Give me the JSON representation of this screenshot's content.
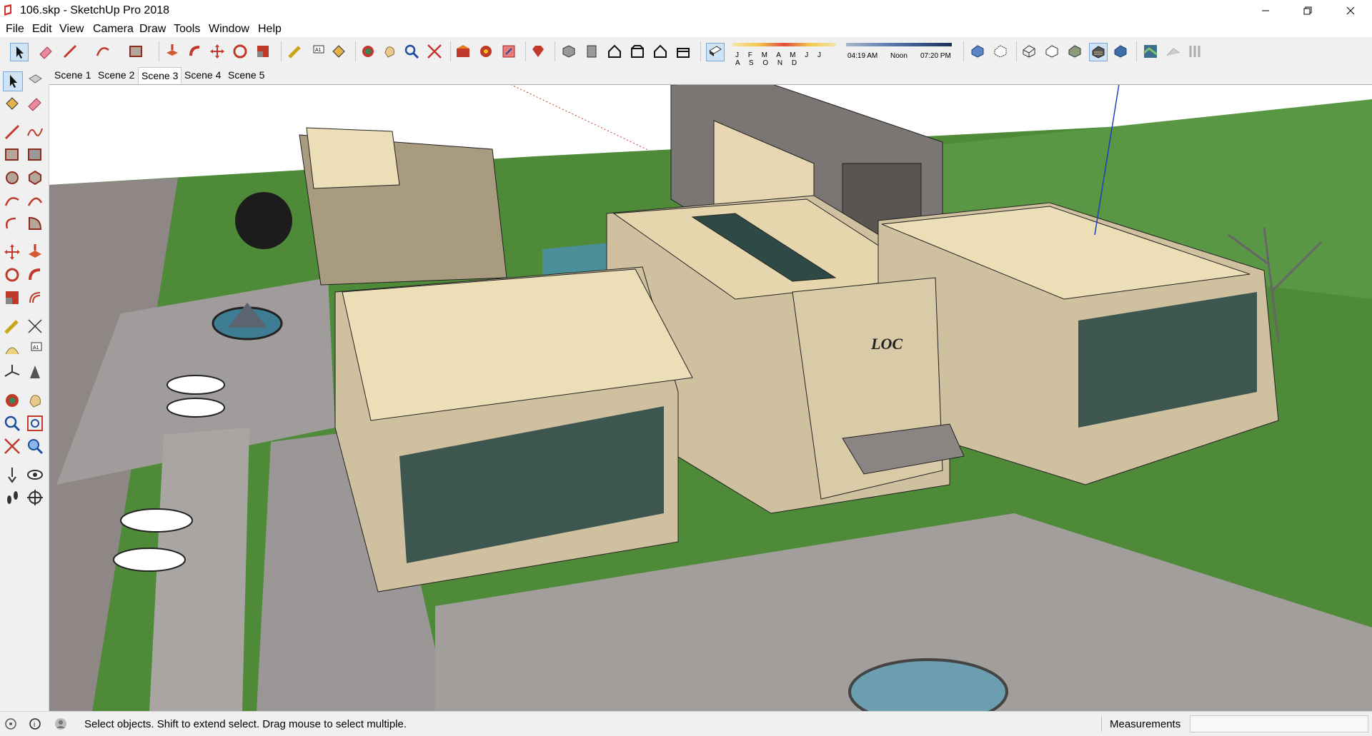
{
  "window": {
    "title": "106.skp - SketchUp Pro 2018",
    "controls": [
      "minimize",
      "maximize",
      "close"
    ]
  },
  "menu": [
    "File",
    "Edit",
    "View",
    "Camera",
    "Draw",
    "Tools",
    "Window",
    "Help"
  ],
  "toolbar": {
    "months": "J F M A M J J A S O N D",
    "time_start": "04:19 AM",
    "time_noon": "Noon",
    "time_end": "07:20 PM",
    "icons": [
      "select-icon",
      "eraser-icon",
      "line-icon",
      "arc-icon",
      "rectangle-icon",
      "push-pull-icon",
      "follow-me-icon",
      "move-icon",
      "rotate-icon",
      "scale-icon",
      "tape-measure-icon",
      "text-icon",
      "paint-bucket-icon",
      "orbit-icon",
      "pan-icon",
      "zoom-icon",
      "zoom-extents-icon",
      "warehouse-icon",
      "extension-warehouse-icon",
      "send-to-layout-icon",
      "ruby-icon",
      "iso-view-icon",
      "top-view-icon",
      "front-view-icon",
      "right-view-icon",
      "back-view-icon",
      "left-view-icon",
      "shadows-icon",
      "xray-icon",
      "back-edges-icon",
      "wireframe-icon",
      "hidden-line-icon",
      "shaded-icon",
      "shaded-texture-icon",
      "monochrome-icon",
      "add-location-icon",
      "show-terrain-icon",
      "photo-texture-icon"
    ]
  },
  "scenes": {
    "tabs": [
      "Scene 1",
      "Scene 2",
      "Scene 3",
      "Scene 4",
      "Scene 5"
    ],
    "active_index": 2
  },
  "model": {
    "entrance_sign": "LOC"
  },
  "status": {
    "message": "Select objects. Shift to extend select. Drag mouse to select multiple.",
    "measurements_label": "Measurements",
    "measurements_value": ""
  },
  "colors": {
    "wall": "#cfc1a0",
    "roof": "#ecdfb8",
    "grass": "#4e8a38",
    "pavement": "#9f9c9b",
    "glass": "#3e5650",
    "sky": "#ffffff"
  }
}
